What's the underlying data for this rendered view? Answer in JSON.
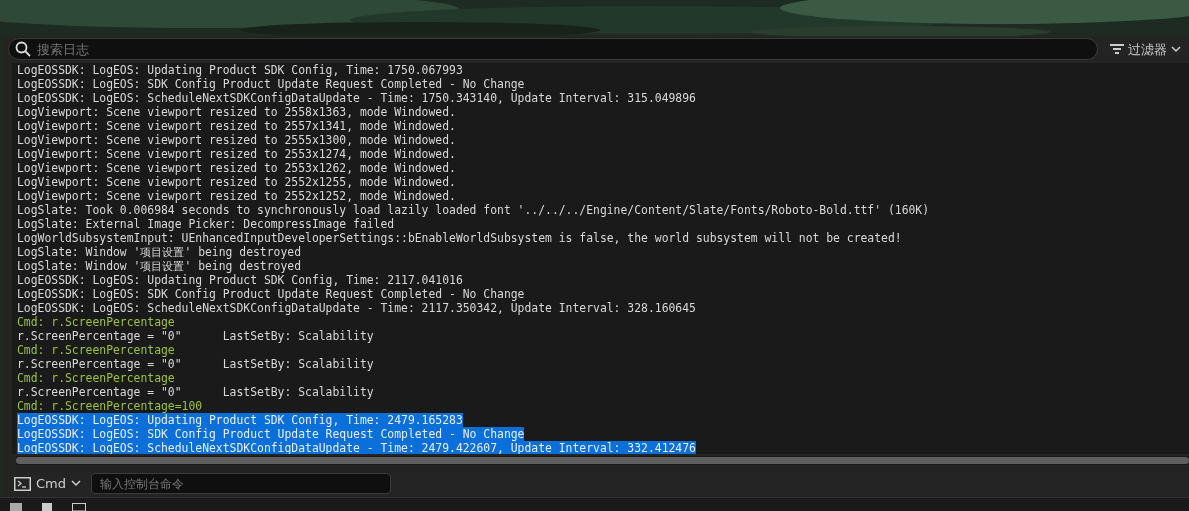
{
  "search": {
    "placeholder": "搜索日志"
  },
  "filter": {
    "label": "过滤器"
  },
  "log_lines": [
    {
      "text": "LogEOSSDK: LogEOS: Updating Product SDK Config, Time: 1750.067993",
      "kind": "log",
      "selected": false
    },
    {
      "text": "LogEOSSDK: LogEOS: SDK Config Product Update Request Completed - No Change",
      "kind": "log",
      "selected": false
    },
    {
      "text": "LogEOSSDK: LogEOS: ScheduleNextSDKConfigDataUpdate - Time: 1750.343140, Update Interval: 315.049896",
      "kind": "log",
      "selected": false
    },
    {
      "text": "LogViewport: Scene viewport resized to 2558x1363, mode Windowed.",
      "kind": "log",
      "selected": false
    },
    {
      "text": "LogViewport: Scene viewport resized to 2557x1341, mode Windowed.",
      "kind": "log",
      "selected": false
    },
    {
      "text": "LogViewport: Scene viewport resized to 2555x1300, mode Windowed.",
      "kind": "log",
      "selected": false
    },
    {
      "text": "LogViewport: Scene viewport resized to 2553x1274, mode Windowed.",
      "kind": "log",
      "selected": false
    },
    {
      "text": "LogViewport: Scene viewport resized to 2553x1262, mode Windowed.",
      "kind": "log",
      "selected": false
    },
    {
      "text": "LogViewport: Scene viewport resized to 2552x1255, mode Windowed.",
      "kind": "log",
      "selected": false
    },
    {
      "text": "LogViewport: Scene viewport resized to 2552x1252, mode Windowed.",
      "kind": "log",
      "selected": false
    },
    {
      "text": "LogSlate: Took 0.006984 seconds to synchronously load lazily loaded font '../../../Engine/Content/Slate/Fonts/Roboto-Bold.ttf' (160K)",
      "kind": "log",
      "selected": false
    },
    {
      "text": "LogSlate: External Image Picker: DecompressImage failed",
      "kind": "log",
      "selected": false
    },
    {
      "text": "LogWorldSubsystemInput: UEnhancedInputDeveloperSettings::bEnableWorldSubsystem is false, the world subsystem will not be created!",
      "kind": "log",
      "selected": false
    },
    {
      "text": "LogSlate: Window '项目设置' being destroyed",
      "kind": "log",
      "selected": false
    },
    {
      "text": "LogSlate: Window '项目设置' being destroyed",
      "kind": "log",
      "selected": false
    },
    {
      "text": "LogEOSSDK: LogEOS: Updating Product SDK Config, Time: 2117.041016",
      "kind": "log",
      "selected": false
    },
    {
      "text": "LogEOSSDK: LogEOS: SDK Config Product Update Request Completed - No Change",
      "kind": "log",
      "selected": false
    },
    {
      "text": "LogEOSSDK: LogEOS: ScheduleNextSDKConfigDataUpdate - Time: 2117.350342, Update Interval: 328.160645",
      "kind": "log",
      "selected": false
    },
    {
      "text": "Cmd: r.ScreenPercentage",
      "kind": "command",
      "selected": false
    },
    {
      "text": "r.ScreenPercentage = \"0\"      LastSetBy: Scalability",
      "kind": "log",
      "selected": false
    },
    {
      "text": "Cmd: r.ScreenPercentage",
      "kind": "command",
      "selected": false
    },
    {
      "text": "r.ScreenPercentage = \"0\"      LastSetBy: Scalability",
      "kind": "log",
      "selected": false
    },
    {
      "text": "Cmd: r.ScreenPercentage",
      "kind": "command",
      "selected": false
    },
    {
      "text": "r.ScreenPercentage = \"0\"      LastSetBy: Scalability",
      "kind": "log",
      "selected": false
    },
    {
      "text": "Cmd: r.ScreenPercentage=100",
      "kind": "command",
      "selected": false
    },
    {
      "text": "LogEOSSDK: LogEOS: Updating Product SDK Config, Time: 2479.165283",
      "kind": "log",
      "selected": true
    },
    {
      "text": "LogEOSSDK: LogEOS: SDK Config Product Update Request Completed - No Change",
      "kind": "log",
      "selected": true
    },
    {
      "text": "LogEOSSDK: LogEOS: ScheduleNextSDKConfigDataUpdate - Time: 2479.422607, Update Interval: 332.412476",
      "kind": "log",
      "selected": true
    }
  ],
  "command_bar": {
    "mode": "Cmd",
    "placeholder": "输入控制台命令"
  }
}
